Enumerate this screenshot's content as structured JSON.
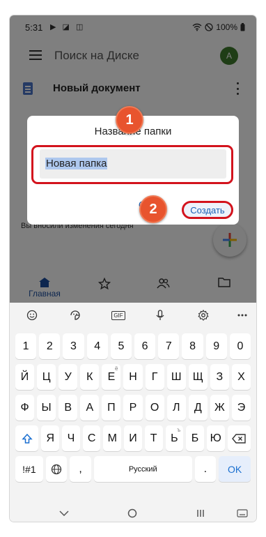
{
  "status_bar": {
    "time": "5:31",
    "left_icons": "▶ ◪ ◫",
    "battery": "100%"
  },
  "header": {
    "search_text": "Поиск на Диске",
    "avatar_letter": "А"
  },
  "doc_row": {
    "title": "Новый документ"
  },
  "background_text": "Вы вносили изменения сегодня",
  "bottom_nav": {
    "home_label": "Главная"
  },
  "dialog": {
    "title": "Название папки",
    "input_value": "Новая папка",
    "cancel_label": "О",
    "create_label": "Создать"
  },
  "steps": {
    "one": "1",
    "two": "2"
  },
  "keyboard": {
    "gif_label": "GIF",
    "number_row": [
      "1",
      "2",
      "3",
      "4",
      "5",
      "6",
      "7",
      "8",
      "9",
      "0"
    ],
    "row1": [
      "Й",
      "Ц",
      "У",
      "К",
      "Е",
      "Н",
      "Г",
      "Ш",
      "Щ",
      "З",
      "Х"
    ],
    "row1_hint": "ё",
    "row2": [
      "Ф",
      "Ы",
      "В",
      "А",
      "П",
      "Р",
      "О",
      "Л",
      "Д",
      "Ж",
      "Э"
    ],
    "row3": [
      "Я",
      "Ч",
      "С",
      "М",
      "И",
      "Т",
      "Ь",
      "Б",
      "Ю"
    ],
    "row3_hint": "ъ",
    "symbols_label": "!#1",
    "comma_label": ",",
    "space_label": "Русский",
    "period_label": ".",
    "ok_label": "OK"
  },
  "colors": {
    "accent": "#1a5fb4",
    "highlight": "#d3131d",
    "step_badge": "#e8542e"
  },
  "icons": [
    "menu-icon",
    "more-icon",
    "doc-icon",
    "plus-icon",
    "home-icon",
    "star-icon",
    "shared-icon",
    "folder-icon",
    "emoji-icon",
    "sticker-icon",
    "gif-icon",
    "mic-icon",
    "settings-icon",
    "more-dots-icon",
    "shift-icon",
    "backspace-icon",
    "globe-icon",
    "back-icon",
    "home-circle-icon",
    "recents-icon",
    "keyboard-hide-icon"
  ]
}
